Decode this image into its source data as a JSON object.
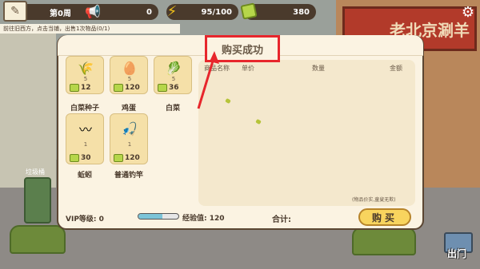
{
  "status_bar": {
    "week": "第0周",
    "hearts": "0",
    "energy": "95/100",
    "money": "380"
  },
  "quest": "前往旧西方，点击当铺，出售1次物品(0/1)",
  "scene": {
    "restaurant_sign": "老北京涮羊",
    "trash_label": "垃圾桶",
    "map_label": "出门"
  },
  "toast": "购买成功",
  "items": [
    {
      "name": "白菜种子",
      "count": "5",
      "price": "12",
      "icon": "seed-packet-icon"
    },
    {
      "name": "鸡蛋",
      "count": "5",
      "price": "120",
      "icon": "egg-icon"
    },
    {
      "name": "白菜",
      "count": "5",
      "price": "36",
      "icon": "cabbage-icon"
    },
    {
      "name": "蚯蚓",
      "count": "1",
      "price": "30",
      "icon": "worm-icon"
    },
    {
      "name": "普通钓竿",
      "count": "1",
      "price": "120",
      "icon": "fishing-rod-icon"
    }
  ],
  "cart": {
    "headers": [
      "商品名称",
      "单价",
      "数量",
      "金额"
    ],
    "note": "(物品价实,童叟无欺)"
  },
  "footer": {
    "vip_label": "VIP等级:",
    "vip_value": "0",
    "exp_label": "经验值:",
    "exp_value": "120",
    "exp_fill": 0.6,
    "total_label": "合计:",
    "buy_label": "购买"
  },
  "colors": {
    "highlight": "#e7262c",
    "panel": "#fbf3e2",
    "accent": "#f8d45e"
  }
}
